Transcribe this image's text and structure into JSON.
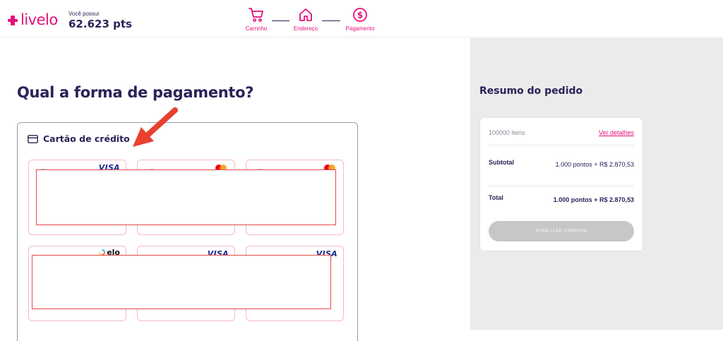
{
  "header": {
    "logo_text": "livelo",
    "points_caption": "Você possui",
    "points_value": "62.623 pts",
    "steps": [
      {
        "label": "Carrinho",
        "icon": "cart-icon"
      },
      {
        "label": "Endereço",
        "icon": "home-icon"
      },
      {
        "label": "Pagamento",
        "icon": "dollar-icon"
      }
    ]
  },
  "main": {
    "title": "Qual a forma de pagamento?",
    "payment_method_label": "Cartão de crédito",
    "cards": [
      {
        "brand": "VISA",
        "icon": "visa-logo"
      },
      {
        "brand": "",
        "icon": "mastercard-logo"
      },
      {
        "brand": "",
        "icon": "mastercard-logo"
      },
      {
        "brand": "elo",
        "icon": "elo-logo"
      },
      {
        "brand": "VISA",
        "icon": "visa-logo"
      },
      {
        "brand": "VISA",
        "icon": "visa-logo"
      }
    ]
  },
  "summary": {
    "title": "Resumo do pedido",
    "items_count": "100000 itens",
    "details_link": "Ver detalhes",
    "subtotal_label": "Subtotal",
    "subtotal_value": "1.000 pontos + R$ 2.870,53",
    "total_label": "Total",
    "total_value": "1.000 pontos + R$ 2.870,53",
    "finalize_button": "FINALIZAR COMPRA"
  },
  "colors": {
    "brand_pink": "#e3107a",
    "brand_navy": "#2a2358",
    "annotation_red": "#e14a4a",
    "panel_gray": "#ebebeb",
    "disabled_button": "#c7c7c7"
  }
}
